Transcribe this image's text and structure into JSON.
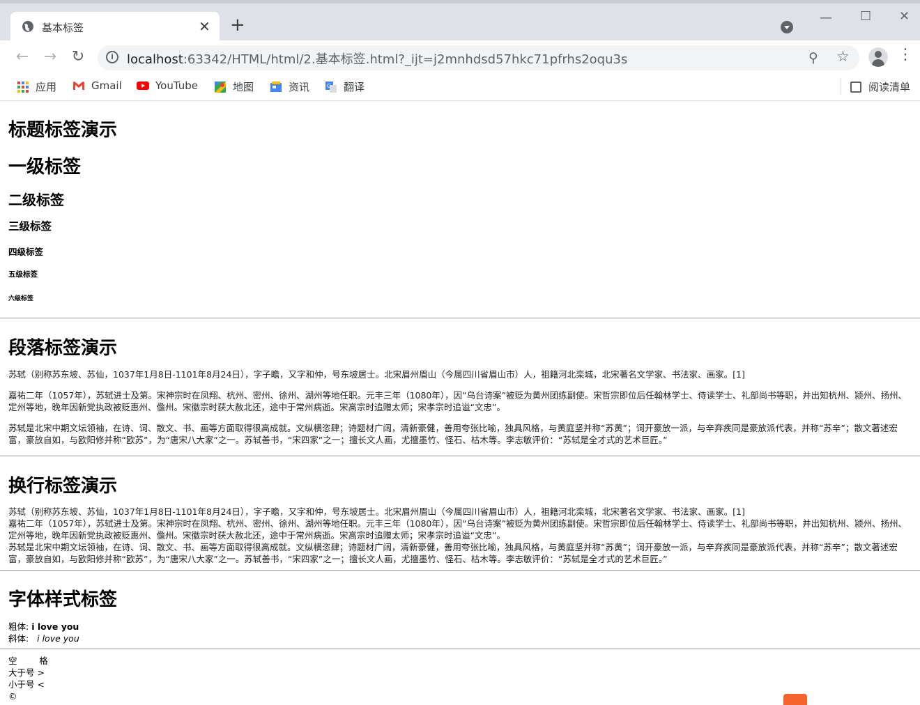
{
  "browser": {
    "tab_title": "基本标签",
    "tab_close": "✕",
    "new_tab": "+",
    "url_host": "localhost",
    "url_rest": ":63342/HTML/html/2.基本标签.html?_ijt=j2mnhdsd57hkc71pfrhs2oqu3s",
    "bookmarks": [
      "应用",
      "Gmail",
      "YouTube",
      "地图",
      "资讯",
      "翻译"
    ],
    "reading_list": "阅读清单"
  },
  "page": {
    "h1_title": "标题标签演示",
    "h1": "一级标签",
    "h2": "二级标签",
    "h3": "三级标签",
    "h4": "四级标签",
    "h5": "五级标签",
    "h6": "六级标签",
    "para_title": "段落标签演示",
    "para1": "苏轼（别称苏东坡、苏仙，1037年1月8日-1101年8月24日），字子瞻，又字和仲，号东坡居士。北宋眉州眉山（今属四川省眉山市）人，祖籍河北栾城，北宋著名文学家、书法家、画家。[1]",
    "para2": "嘉祐二年（1057年），苏轼进士及第。宋神宗时在凤翔、杭州、密州、徐州、湖州等地任职。元丰三年（1080年），因“乌台诗案”被贬为黄州团练副使。宋哲宗即位后任翰林学士、侍读学士、礼部尚书等职，并出知杭州、颍州、扬州、定州等地，晚年因新党执政被贬惠州、儋州。宋徽宗时获大赦北还，途中于常州病逝。宋高宗时追赠太师；宋孝宗时追谥“文忠”。",
    "para3": "苏轼是北宋中期文坛领袖，在诗、词、散文、书、画等方面取得很高成就。文纵横恣肆；诗题材广阔，清新豪健，善用夸张比喻，独具风格，与黄庭坚并称“苏黄”；词开豪放一派，与辛弃疾同是豪放派代表，并称“苏辛”；散文著述宏富，豪放自如，与欧阳修并称“欧苏”，为“唐宋八大家”之一。苏轼善书，“宋四家”之一；擅长文人画，尤擅墨竹、怪石、枯木等。李志敏评价：“苏轼是全才式的艺术巨匠。”",
    "br_title": "换行标签演示",
    "font_title": "字体样式标签",
    "bold_label": "粗体:",
    "bold_text": "i love you",
    "italic_label": "斜体:",
    "italic_text": "i love you",
    "space_line": "空        格",
    "gt_line": "大于号 >",
    "lt_line": "小于号 <",
    "copy_line": "©"
  },
  "colors": {
    "gmail_red": "#ea4335",
    "youtube_red": "#ff0000",
    "maps_green": "#34a853",
    "news_blue": "#4285f4",
    "translate_blue": "#4285f4"
  }
}
